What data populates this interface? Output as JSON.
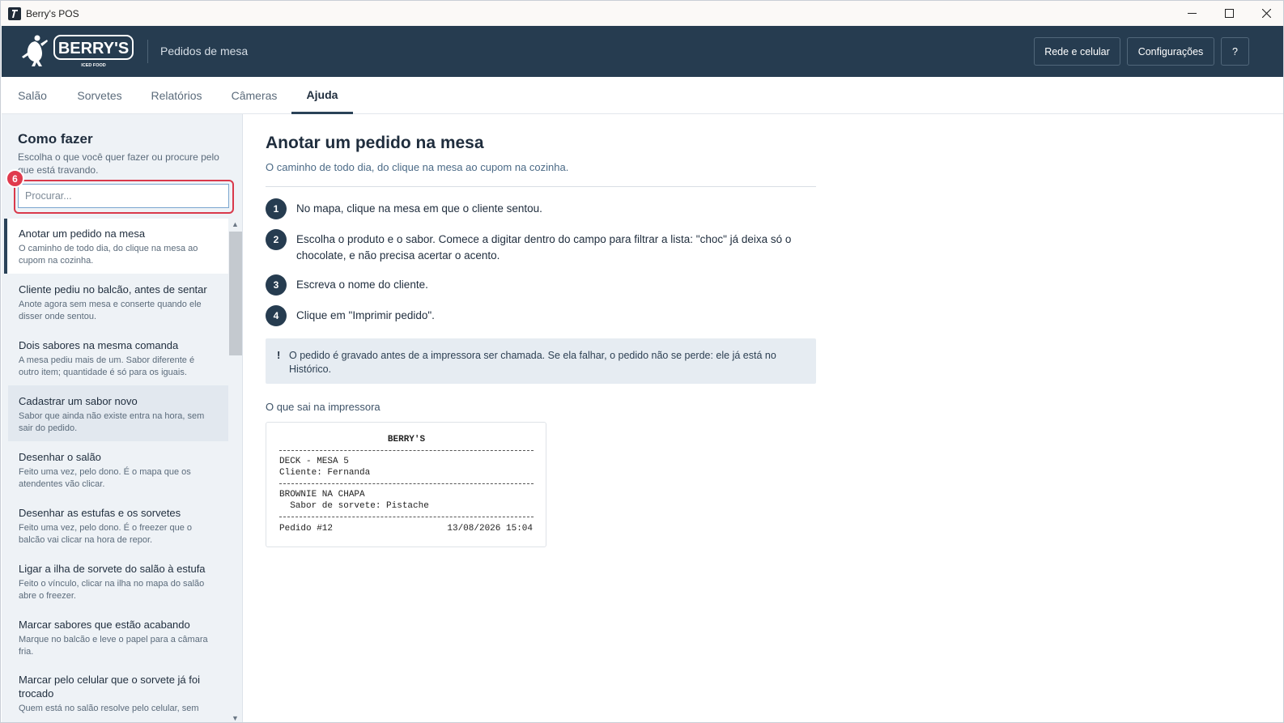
{
  "window": {
    "title": "Berry's POS",
    "app_icon_glyph": "?"
  },
  "header": {
    "brand": "BERRY'S",
    "brand_tagline": "ICED FOOD",
    "title": "Pedidos de mesa",
    "buttons": {
      "network": "Rede e celular",
      "settings": "Configurações",
      "help": "?"
    }
  },
  "tabs": [
    {
      "label": "Salão",
      "active": false
    },
    {
      "label": "Sorvetes",
      "active": false
    },
    {
      "label": "Relatórios",
      "active": false
    },
    {
      "label": "Câmeras",
      "active": false
    },
    {
      "label": "Ajuda",
      "active": true
    }
  ],
  "sidebar": {
    "title": "Como fazer",
    "subtitle": "Escolha o que você quer fazer ou procure pelo que está travando.",
    "search": {
      "placeholder": "Procurar...",
      "value": ""
    },
    "badge": "6",
    "items": [
      {
        "title": "Anotar um pedido na mesa",
        "desc": "O caminho de todo dia, do clique na mesa ao cupom na cozinha.",
        "state": "active"
      },
      {
        "title": "Cliente pediu no balcão, antes de sentar",
        "desc": "Anote agora sem mesa e conserte quando ele disser onde sentou.",
        "state": ""
      },
      {
        "title": "Dois sabores na mesma comanda",
        "desc": "A mesa pediu mais de um. Sabor diferente é outro item; quantidade é só para os iguais.",
        "state": ""
      },
      {
        "title": "Cadastrar um sabor novo",
        "desc": "Sabor que ainda não existe entra na hora, sem sair do pedido.",
        "state": "hover"
      },
      {
        "title": "Desenhar o salão",
        "desc": "Feito uma vez, pelo dono. É o mapa que os atendentes vão clicar.",
        "state": ""
      },
      {
        "title": "Desenhar as estufas e os sorvetes",
        "desc": "Feito uma vez, pelo dono. É o freezer que o balcão vai clicar na hora de repor.",
        "state": ""
      },
      {
        "title": "Ligar a ilha de sorvete do salão à estufa",
        "desc": "Feito o vínculo, clicar na ilha no mapa do salão abre o freezer.",
        "state": ""
      },
      {
        "title": "Marcar sabores que estão acabando",
        "desc": "Marque no balcão e leve o papel para a câmara fria.",
        "state": ""
      },
      {
        "title": "Marcar pelo celular que o sorvete já foi trocado",
        "desc": "Quem está no salão resolve pelo celular, sem",
        "state": ""
      }
    ]
  },
  "main": {
    "title": "Anotar um pedido na mesa",
    "subtitle": "O caminho de todo dia, do clique na mesa ao cupom na cozinha.",
    "steps": [
      {
        "num": "1",
        "text": "No mapa, clique na mesa em que o cliente sentou."
      },
      {
        "num": "2",
        "text": "Escolha o produto e o sabor. Comece a digitar dentro do campo para filtrar a lista: \"choc\" já deixa só o chocolate, e não precisa acertar o acento."
      },
      {
        "num": "3",
        "text": "Escreva o nome do cliente."
      },
      {
        "num": "4",
        "text": "Clique em \"Imprimir pedido\"."
      }
    ],
    "note": {
      "icon": "!",
      "text": "O pedido é gravado antes de a impressora ser chamada. Se ela falhar, o pedido não se perde: ele já está no Histórico."
    },
    "printer_label": "O que sai na impressora",
    "receipt": {
      "header": "BERRY'S",
      "location": "DECK - MESA 5",
      "customer": "Cliente: Fernanda",
      "product": "BROWNIE NA CHAPA",
      "flavor": "  Sabor de sorvete: Pistache",
      "order": "Pedido #12",
      "datetime": "13/08/2026 15:04"
    }
  },
  "colors": {
    "header_bg": "#263c50",
    "sidebar_bg": "#eef2f6",
    "accent_red": "#e03a4d",
    "note_bg": "#e6ecf2"
  }
}
